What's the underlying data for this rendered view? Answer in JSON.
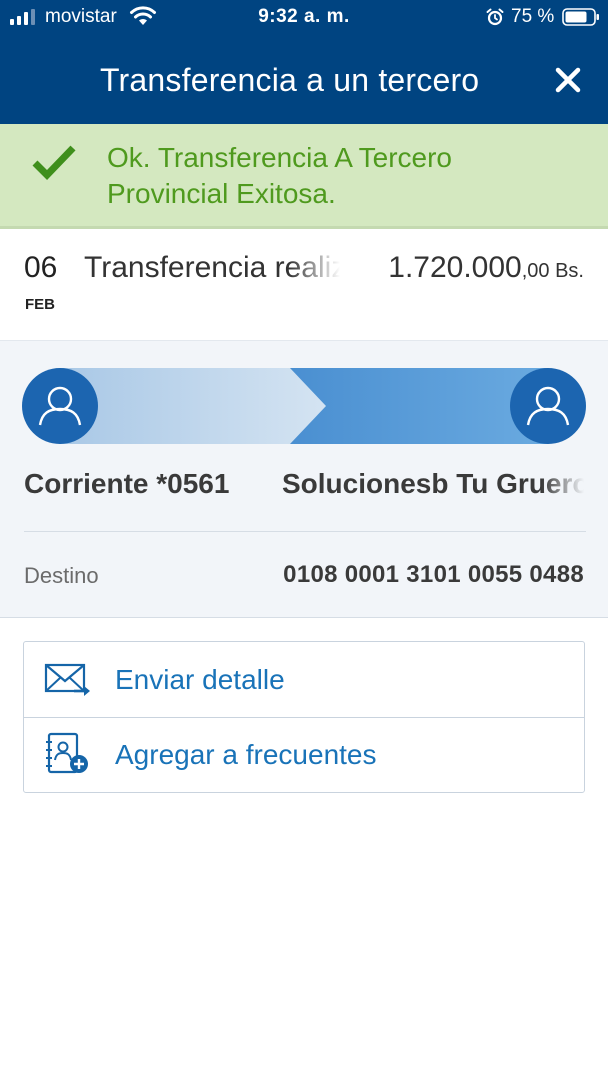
{
  "status_bar": {
    "carrier": "movistar",
    "time": "9:32 a. m.",
    "battery": "75 %"
  },
  "header": {
    "title": "Transferencia a un tercero",
    "close_icon": "close-icon"
  },
  "alert": {
    "type": "success",
    "icon": "checkmark-icon",
    "message": "Ok. Transferencia A Tercero Provincial Exitosa."
  },
  "transaction": {
    "day": "06",
    "month": "FEB",
    "description": "Transferencia realizada",
    "amount_integer": "1.720.000",
    "amount_decimal": ",00 Bs."
  },
  "transfer_flow": {
    "origin_account": "Corriente *0561",
    "destination_name": "Solucionesb Tu Gruero",
    "destination_label": "Destino",
    "destination_account": "0108 0001 3101 0055 0488"
  },
  "actions": [
    {
      "label": "Enviar detalle",
      "icon": "mail-send-icon"
    },
    {
      "label": "Agregar a frecuentes",
      "icon": "add-contact-book-icon"
    }
  ],
  "colors": {
    "brand": "#004481",
    "success_bg": "#d4e8c0",
    "success_text": "#4f9a1e",
    "link": "#1973b8"
  }
}
